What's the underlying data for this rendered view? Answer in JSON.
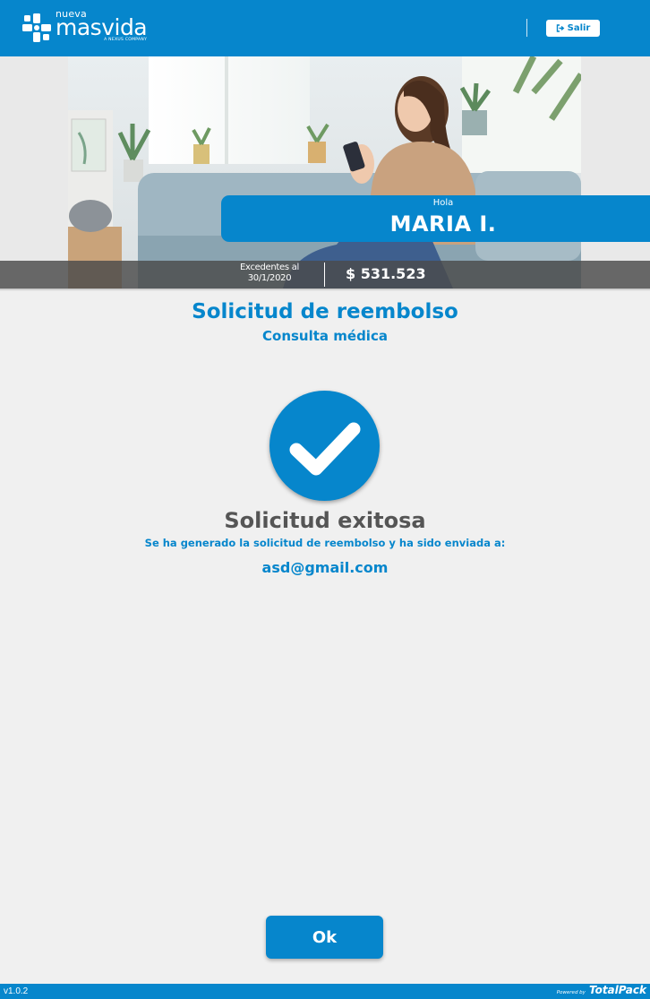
{
  "header": {
    "brand_small": "nueva",
    "brand_big": "masvida",
    "brand_tagline": "A NEXUS COMPANY",
    "logout_label": "Salir",
    "logout_icon": "sign-out-icon",
    "background": "#0686cc"
  },
  "hero": {
    "greeting": "Hola",
    "user_name": "MARIA I.",
    "balance_label": "Excedentes al 30/1/2020",
    "balance_amount": "$ 531.523"
  },
  "main": {
    "title": "Solicitud de reembolso",
    "subtitle": "Consulta médica",
    "status_icon": "checkmark-icon",
    "success_title": "Solicitud exitosa",
    "success_message": "Se ha generado la solicitud de reembolso y ha sido enviada a:",
    "email": "asd@gmail.com",
    "ok_label": "Ok"
  },
  "footer": {
    "version": "v1.0.2",
    "powered_by": "Powered by",
    "powered_brand": "TotalPack"
  },
  "colors": {
    "primary": "#0686cc",
    "text_dark": "#555555",
    "background": "#f0f0f0"
  }
}
